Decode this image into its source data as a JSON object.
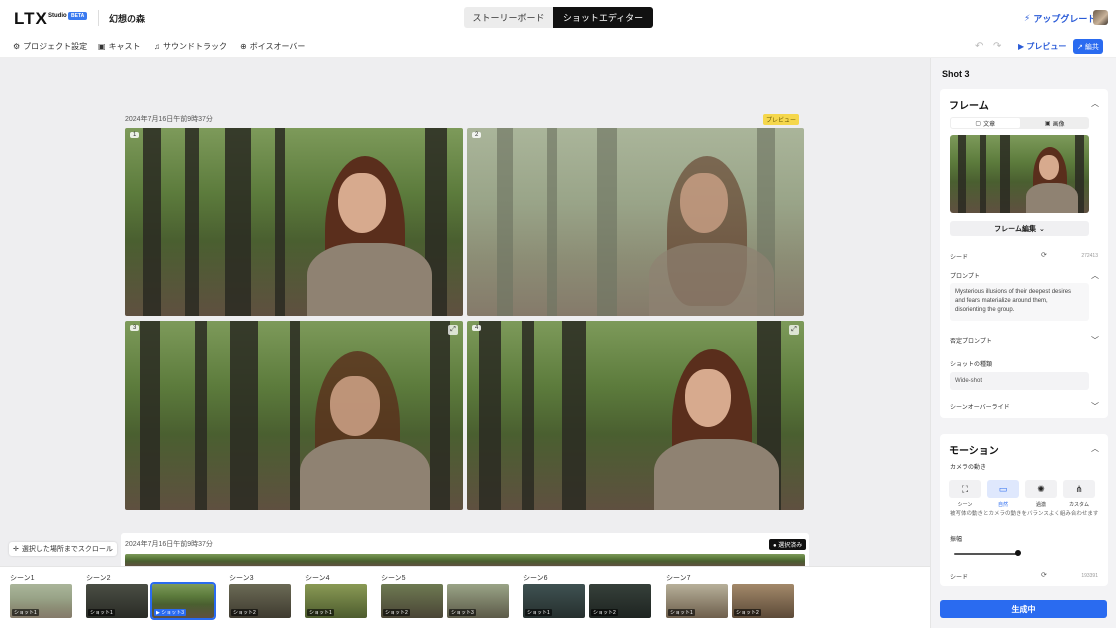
{
  "app": {
    "logo": "LTX",
    "logo_sub": "Studio",
    "beta": "BETA",
    "project_name": "幻想の森"
  },
  "view_toggle": {
    "storyboard": "ストーリーボード",
    "shot_editor": "ショットエディター"
  },
  "header": {
    "upgrade": "アップグレード"
  },
  "toolbar": {
    "project_settings": "プロジェクト設定",
    "cast": "キャスト",
    "soundtrack": "サウンドトラック",
    "voiceover": "ボイスオーバー",
    "preview": "プレビュー",
    "share": "編共"
  },
  "canvas": {
    "generation_time_1": "2024年7月16日午前9時37分",
    "generation_time_2": "2024年7月16日午前9時37分",
    "preview_tag": "プレビュー",
    "selected_tag": "選択済み",
    "frames": [
      {
        "num": "1"
      },
      {
        "num": "2"
      },
      {
        "num": "3"
      },
      {
        "num": "4"
      }
    ],
    "scroll_to_selected": "選択した場所までスクロール"
  },
  "timeline": {
    "scenes": [
      {
        "label": "シーン1",
        "shots": [
          "ショット1"
        ]
      },
      {
        "label": "シーン2",
        "shots": [
          "ショット1",
          "ショット3"
        ]
      },
      {
        "label": "シーン3",
        "shots": [
          "ショット2"
        ]
      },
      {
        "label": "シーン4",
        "shots": [
          "ショット1"
        ]
      },
      {
        "label": "シーン5",
        "shots": [
          "ショット2",
          "ショット3"
        ]
      },
      {
        "label": "シーン6",
        "shots": [
          "ショット1",
          "ショット2"
        ]
      },
      {
        "label": "シーン7",
        "shots": [
          "ショット1",
          "ショット2"
        ]
      }
    ]
  },
  "panel": {
    "shot_title": "Shot 3",
    "frame": {
      "heading": "フレーム",
      "tab_text": "文章",
      "tab_image": "画像",
      "edit_frame": "フレーム編集",
      "seed_label": "シード",
      "seed_value": "272413",
      "prompt_label": "プロンプト",
      "prompt_text": "Mysterious illusions of their deepest desires and fears materialize around them, disorienting the group.",
      "negative_prompt_label": "否定プロンプト",
      "shot_type_label": "ショットの種類",
      "shot_type_value": "Wide-shot",
      "scene_override_label": "シーンオーバーライド"
    },
    "motion": {
      "heading": "モーション",
      "camera_label": "カメラの動き",
      "options": [
        "シーン",
        "自然",
        "過激",
        "カスタム"
      ],
      "selected_index": 1,
      "description": "被写体の動きとカメラの動きをバランスよく組み合わせます",
      "amplitude_label": "振幅",
      "amplitude_level": 1.0,
      "seed_label": "シード",
      "seed_value": "193391"
    },
    "generate": "生成中"
  },
  "colors": {
    "accent": "#2a6bf0",
    "preview_tag": "#f5d74c"
  }
}
